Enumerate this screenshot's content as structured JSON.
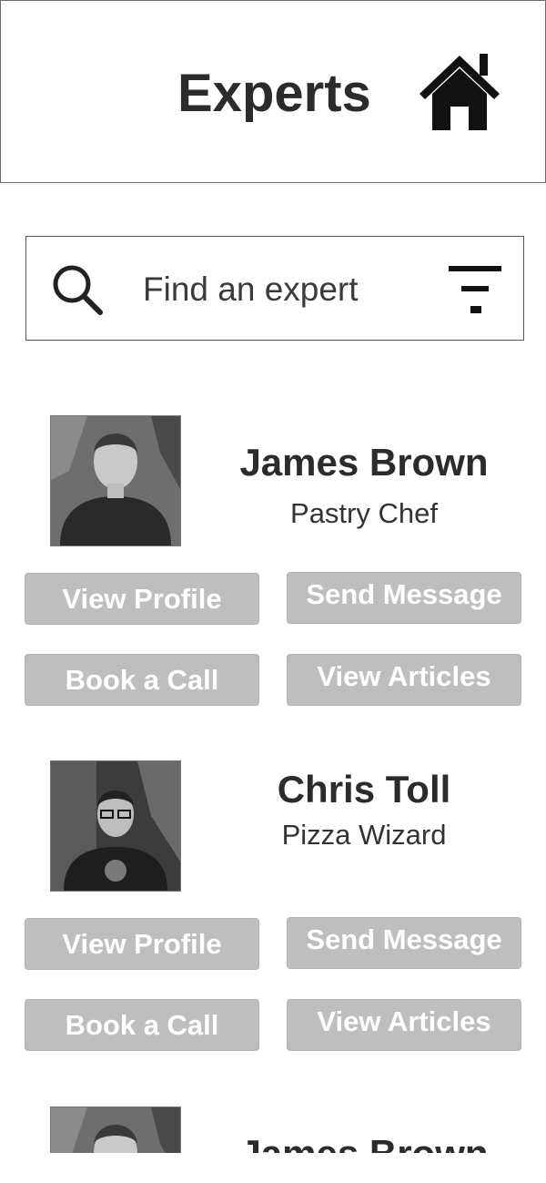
{
  "header": {
    "title": "Experts",
    "home_icon": "home-icon"
  },
  "search": {
    "placeholder": "Find an expert",
    "value": "",
    "search_icon": "search-icon",
    "filter_icon": "filter-icon"
  },
  "experts": [
    {
      "name": "James Brown",
      "role": "Pastry Chef",
      "buttons": {
        "view_profile": "View Profile",
        "send_message": "Send Message",
        "book_call": "Book a Call",
        "view_articles": "View Articles"
      }
    },
    {
      "name": "Chris Toll",
      "role": "Pizza Wizard",
      "buttons": {
        "view_profile": "View Profile",
        "send_message": "Send Message",
        "book_call": "Book a Call",
        "view_articles": "View Articles"
      }
    },
    {
      "name": "James Brown"
    }
  ],
  "colors": {
    "button_bg": "#bebebf",
    "button_text": "#ffffff",
    "text": "#2b2b2b",
    "border": "#6b6b6b"
  }
}
